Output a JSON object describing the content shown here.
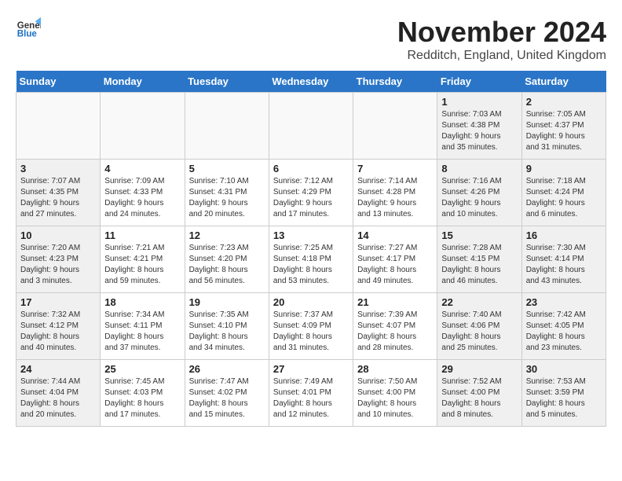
{
  "header": {
    "logo_line1": "General",
    "logo_line2": "Blue",
    "month_title": "November 2024",
    "location": "Redditch, England, United Kingdom"
  },
  "weekdays": [
    "Sunday",
    "Monday",
    "Tuesday",
    "Wednesday",
    "Thursday",
    "Friday",
    "Saturday"
  ],
  "weeks": [
    [
      {
        "day": "",
        "info": "",
        "type": "empty"
      },
      {
        "day": "",
        "info": "",
        "type": "empty"
      },
      {
        "day": "",
        "info": "",
        "type": "empty"
      },
      {
        "day": "",
        "info": "",
        "type": "empty"
      },
      {
        "day": "",
        "info": "",
        "type": "empty"
      },
      {
        "day": "1",
        "info": "Sunrise: 7:03 AM\nSunset: 4:38 PM\nDaylight: 9 hours\nand 35 minutes.",
        "type": "weekend"
      },
      {
        "day": "2",
        "info": "Sunrise: 7:05 AM\nSunset: 4:37 PM\nDaylight: 9 hours\nand 31 minutes.",
        "type": "weekend"
      }
    ],
    [
      {
        "day": "3",
        "info": "Sunrise: 7:07 AM\nSunset: 4:35 PM\nDaylight: 9 hours\nand 27 minutes.",
        "type": "weekend"
      },
      {
        "day": "4",
        "info": "Sunrise: 7:09 AM\nSunset: 4:33 PM\nDaylight: 9 hours\nand 24 minutes.",
        "type": "weekday"
      },
      {
        "day": "5",
        "info": "Sunrise: 7:10 AM\nSunset: 4:31 PM\nDaylight: 9 hours\nand 20 minutes.",
        "type": "weekday"
      },
      {
        "day": "6",
        "info": "Sunrise: 7:12 AM\nSunset: 4:29 PM\nDaylight: 9 hours\nand 17 minutes.",
        "type": "weekday"
      },
      {
        "day": "7",
        "info": "Sunrise: 7:14 AM\nSunset: 4:28 PM\nDaylight: 9 hours\nand 13 minutes.",
        "type": "weekday"
      },
      {
        "day": "8",
        "info": "Sunrise: 7:16 AM\nSunset: 4:26 PM\nDaylight: 9 hours\nand 10 minutes.",
        "type": "weekend"
      },
      {
        "day": "9",
        "info": "Sunrise: 7:18 AM\nSunset: 4:24 PM\nDaylight: 9 hours\nand 6 minutes.",
        "type": "weekend"
      }
    ],
    [
      {
        "day": "10",
        "info": "Sunrise: 7:20 AM\nSunset: 4:23 PM\nDaylight: 9 hours\nand 3 minutes.",
        "type": "weekend"
      },
      {
        "day": "11",
        "info": "Sunrise: 7:21 AM\nSunset: 4:21 PM\nDaylight: 8 hours\nand 59 minutes.",
        "type": "weekday"
      },
      {
        "day": "12",
        "info": "Sunrise: 7:23 AM\nSunset: 4:20 PM\nDaylight: 8 hours\nand 56 minutes.",
        "type": "weekday"
      },
      {
        "day": "13",
        "info": "Sunrise: 7:25 AM\nSunset: 4:18 PM\nDaylight: 8 hours\nand 53 minutes.",
        "type": "weekday"
      },
      {
        "day": "14",
        "info": "Sunrise: 7:27 AM\nSunset: 4:17 PM\nDaylight: 8 hours\nand 49 minutes.",
        "type": "weekday"
      },
      {
        "day": "15",
        "info": "Sunrise: 7:28 AM\nSunset: 4:15 PM\nDaylight: 8 hours\nand 46 minutes.",
        "type": "weekend"
      },
      {
        "day": "16",
        "info": "Sunrise: 7:30 AM\nSunset: 4:14 PM\nDaylight: 8 hours\nand 43 minutes.",
        "type": "weekend"
      }
    ],
    [
      {
        "day": "17",
        "info": "Sunrise: 7:32 AM\nSunset: 4:12 PM\nDaylight: 8 hours\nand 40 minutes.",
        "type": "weekend"
      },
      {
        "day": "18",
        "info": "Sunrise: 7:34 AM\nSunset: 4:11 PM\nDaylight: 8 hours\nand 37 minutes.",
        "type": "weekday"
      },
      {
        "day": "19",
        "info": "Sunrise: 7:35 AM\nSunset: 4:10 PM\nDaylight: 8 hours\nand 34 minutes.",
        "type": "weekday"
      },
      {
        "day": "20",
        "info": "Sunrise: 7:37 AM\nSunset: 4:09 PM\nDaylight: 8 hours\nand 31 minutes.",
        "type": "weekday"
      },
      {
        "day": "21",
        "info": "Sunrise: 7:39 AM\nSunset: 4:07 PM\nDaylight: 8 hours\nand 28 minutes.",
        "type": "weekday"
      },
      {
        "day": "22",
        "info": "Sunrise: 7:40 AM\nSunset: 4:06 PM\nDaylight: 8 hours\nand 25 minutes.",
        "type": "weekend"
      },
      {
        "day": "23",
        "info": "Sunrise: 7:42 AM\nSunset: 4:05 PM\nDaylight: 8 hours\nand 23 minutes.",
        "type": "weekend"
      }
    ],
    [
      {
        "day": "24",
        "info": "Sunrise: 7:44 AM\nSunset: 4:04 PM\nDaylight: 8 hours\nand 20 minutes.",
        "type": "weekend"
      },
      {
        "day": "25",
        "info": "Sunrise: 7:45 AM\nSunset: 4:03 PM\nDaylight: 8 hours\nand 17 minutes.",
        "type": "weekday"
      },
      {
        "day": "26",
        "info": "Sunrise: 7:47 AM\nSunset: 4:02 PM\nDaylight: 8 hours\nand 15 minutes.",
        "type": "weekday"
      },
      {
        "day": "27",
        "info": "Sunrise: 7:49 AM\nSunset: 4:01 PM\nDaylight: 8 hours\nand 12 minutes.",
        "type": "weekday"
      },
      {
        "day": "28",
        "info": "Sunrise: 7:50 AM\nSunset: 4:00 PM\nDaylight: 8 hours\nand 10 minutes.",
        "type": "weekday"
      },
      {
        "day": "29",
        "info": "Sunrise: 7:52 AM\nSunset: 4:00 PM\nDaylight: 8 hours\nand 8 minutes.",
        "type": "weekend"
      },
      {
        "day": "30",
        "info": "Sunrise: 7:53 AM\nSunset: 3:59 PM\nDaylight: 8 hours\nand 5 minutes.",
        "type": "weekend"
      }
    ]
  ]
}
